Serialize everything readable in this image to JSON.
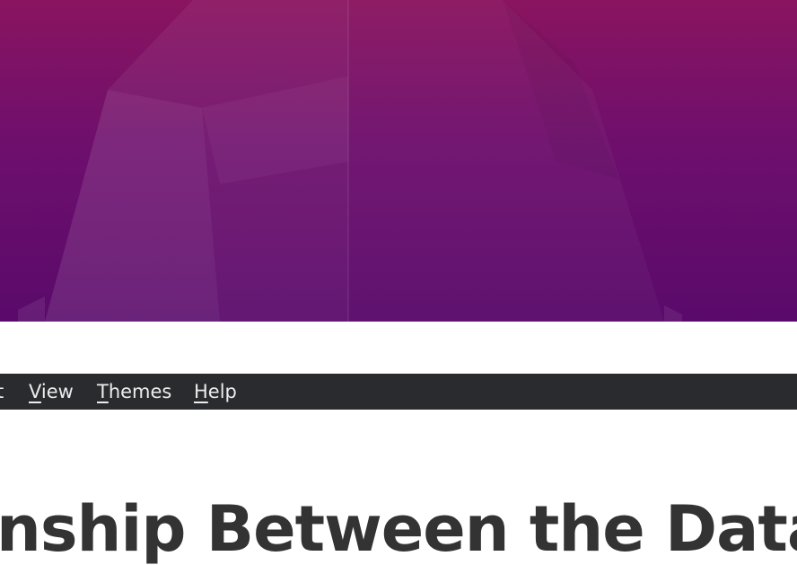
{
  "colors": {
    "wallpaper_top": "#8a1460",
    "wallpaper_bottom": "#5a0a6b",
    "menubar_bg": "#2a2b2e",
    "menubar_text": "#ececec",
    "heading_text": "#333333"
  },
  "menubar": {
    "items": [
      {
        "label": "t",
        "accel": "",
        "rest": "t"
      },
      {
        "label": "View",
        "accel": "V",
        "rest": "iew"
      },
      {
        "label": "Themes",
        "accel": "T",
        "rest": "hemes"
      },
      {
        "label": "Help",
        "accel": "H",
        "rest": "elp"
      }
    ]
  },
  "document": {
    "heading": "nship Between the Data R"
  }
}
